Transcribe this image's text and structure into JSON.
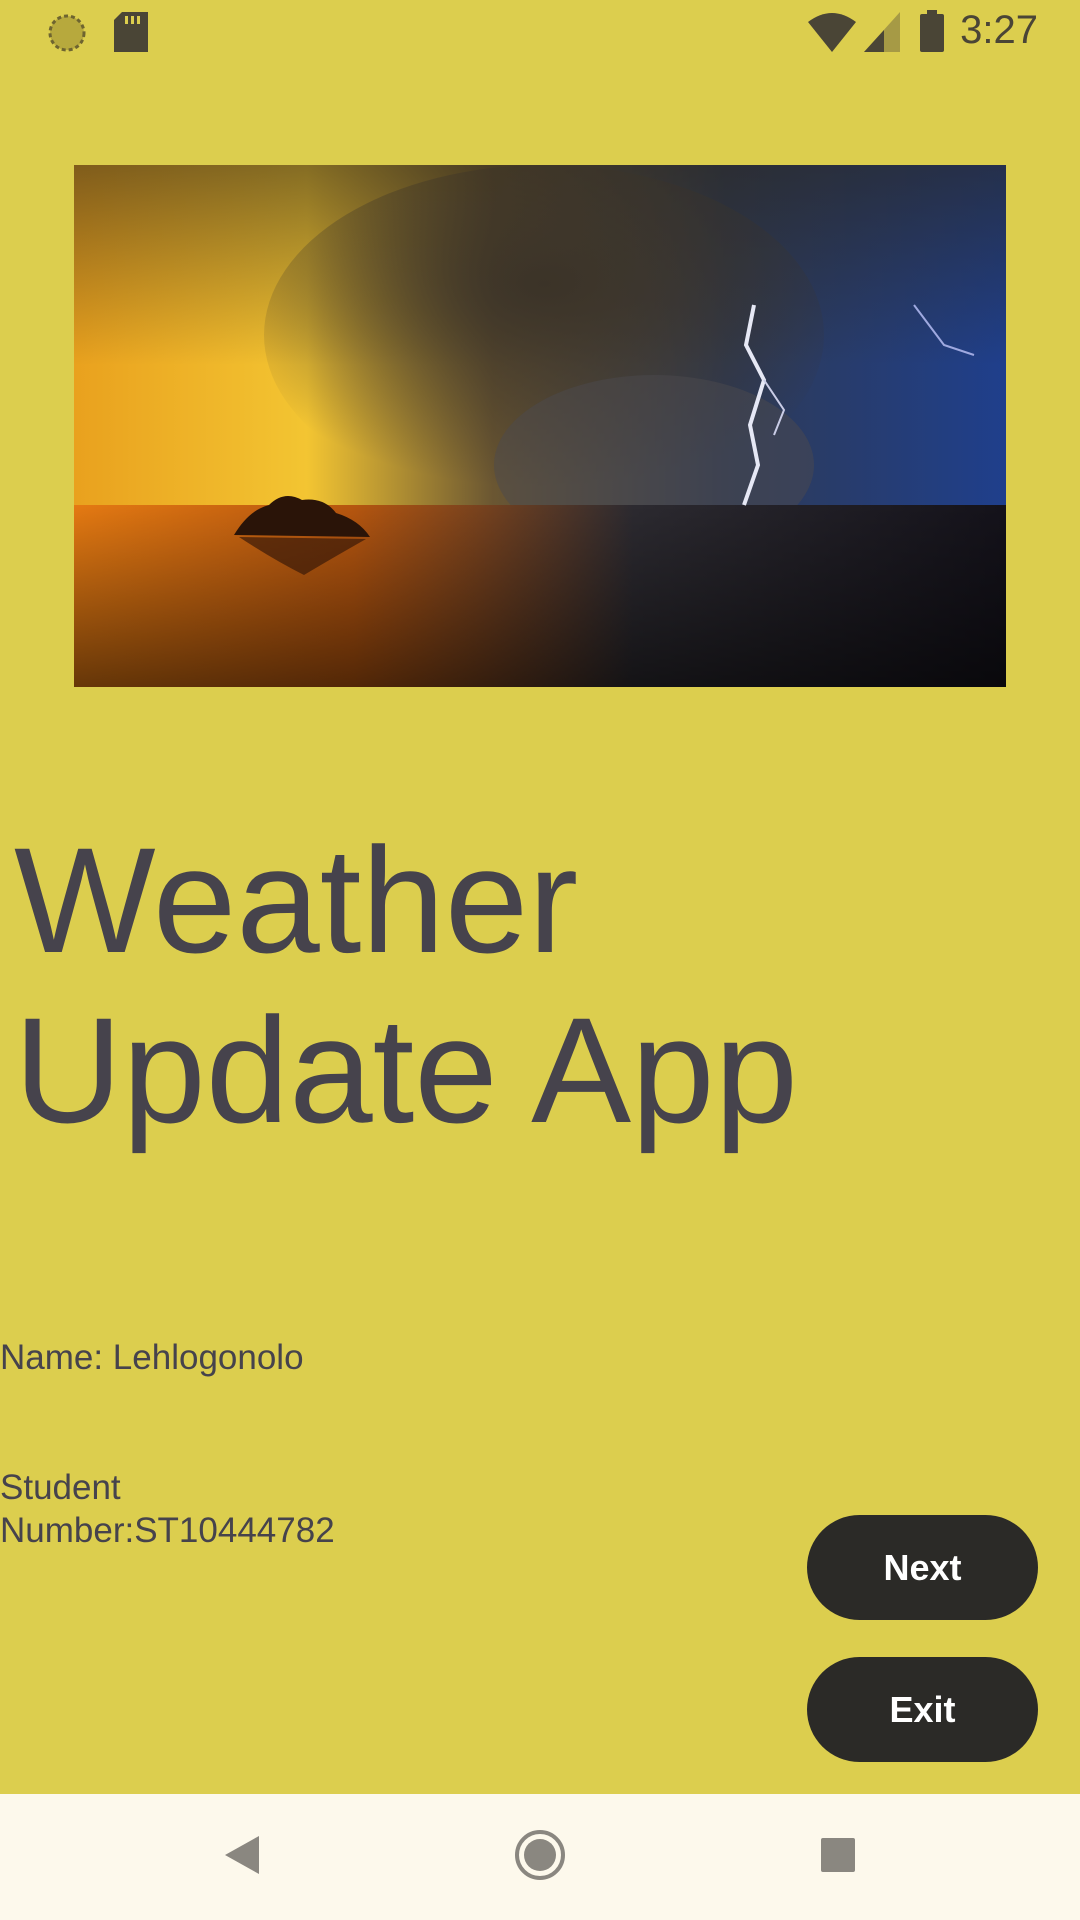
{
  "status_bar": {
    "time": "3:27",
    "left_icons": [
      "loading-icon",
      "sd-card-icon"
    ],
    "right_icons": [
      "wifi-icon",
      "signal-icon",
      "battery-icon"
    ]
  },
  "hero_image": {
    "description_icon": "storm-landscape-image"
  },
  "title": "Weather Update App",
  "info": {
    "name": "Name: Lehlogonolo",
    "student_number": "Student Number:ST10444782"
  },
  "buttons": {
    "next": "Next",
    "exit": "Exit"
  },
  "nav_bar": {
    "items": [
      "back-icon",
      "home-icon",
      "recents-icon"
    ]
  },
  "colors": {
    "background": "#DCCE4E",
    "text": "#46434C",
    "button": "#2B2A27",
    "button_text": "#FFFFFF",
    "nav_bar": "#FDF9EC"
  }
}
